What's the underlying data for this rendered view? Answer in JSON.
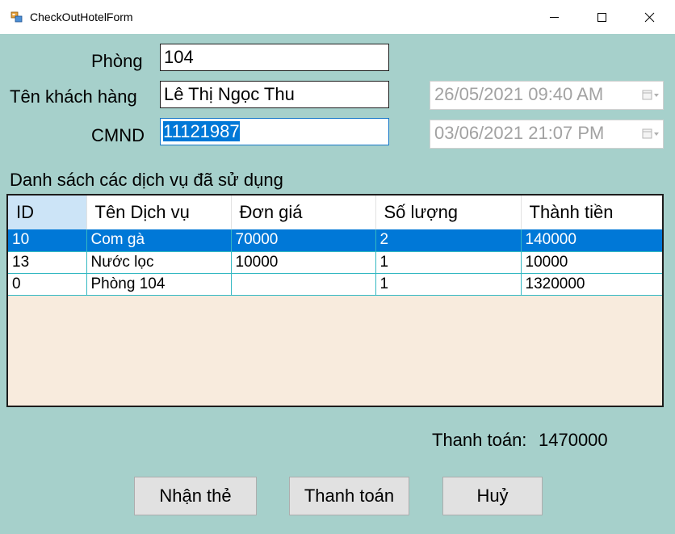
{
  "window": {
    "title": "CheckOutHotelForm"
  },
  "form": {
    "room_label": "Phòng",
    "room_value": "104",
    "customer_label": "Tên khách hàng",
    "customer_value": "Lê Thị Ngọc Thu",
    "id_label": "CMND",
    "id_value": "11121987",
    "checkin_datetime": "26/05/2021 09:40 AM",
    "checkout_datetime": "03/06/2021 21:07 PM"
  },
  "services": {
    "caption": "Danh sách các dịch vụ đã sử dụng",
    "columns": [
      "ID",
      "Tên Dịch vụ",
      "Đơn giá",
      "Số lượng",
      "Thành tiền"
    ],
    "rows": [
      [
        "10",
        "Com gà",
        "70000",
        "2",
        "140000"
      ],
      [
        "13",
        "Nước lọc",
        "10000",
        "1",
        "10000"
      ],
      [
        "0",
        "Phòng 104",
        "",
        "1",
        "1320000"
      ]
    ],
    "selected_row": 0
  },
  "total": {
    "label": "Thanh toán:",
    "value": "1470000"
  },
  "buttons": {
    "receive_card": "Nhận thẻ",
    "pay": "Thanh toán",
    "cancel": "Huỷ"
  },
  "colors": {
    "window_bg": "#a6d0cb",
    "selection": "#0078d7",
    "grid_bg": "#f8ebdd",
    "grid_lines": "#33b8c2"
  }
}
